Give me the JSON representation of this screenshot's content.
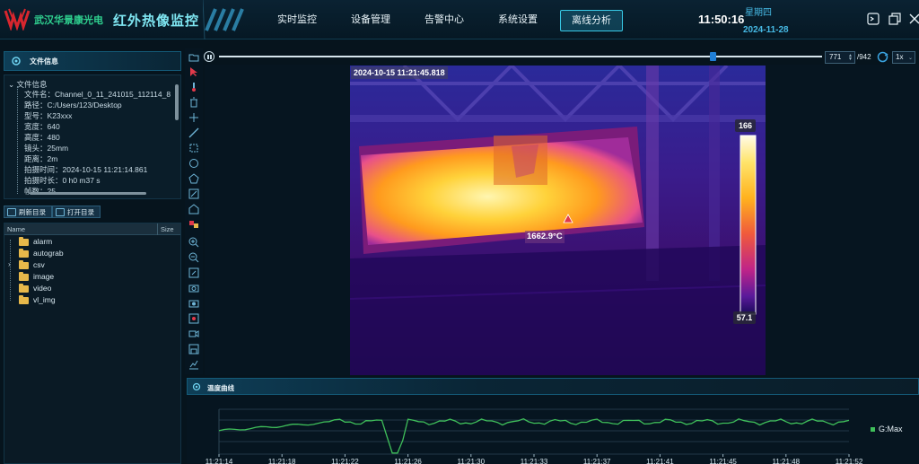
{
  "header": {
    "company": "武汉华景康光电",
    "system_name": "红外热像监控",
    "nav": [
      {
        "label": "实时监控",
        "active": false
      },
      {
        "label": "设备管理",
        "active": false
      },
      {
        "label": "告警中心",
        "active": false
      },
      {
        "label": "系统设置",
        "active": false
      },
      {
        "label": "离线分析",
        "active": true
      }
    ],
    "time": "11:50:16",
    "weekday": "星期四",
    "date": "2024-11-28"
  },
  "file_info": {
    "panel_title": "文件信息",
    "root_label": "文件信息",
    "rows": [
      "文件名：Channel_0_11_241015_112114_8",
      "路径：C:/Users/123/Desktop",
      "型号：K23xxx",
      "宽度：640",
      "高度：480",
      "镜头：25mm",
      "距离：2m",
      "拍摄时间：2024-10-15 11:21:14.861",
      "拍摄时长：0 h0 m37 s",
      "帧数：25"
    ]
  },
  "buttons": {
    "refresh": "刷新目录",
    "open": "打开目录"
  },
  "tree": {
    "col_name": "Name",
    "col_size": "Size",
    "folders": [
      {
        "name": "alarm",
        "expandable": false
      },
      {
        "name": "autograb",
        "expandable": false
      },
      {
        "name": "csv",
        "expandable": true
      },
      {
        "name": "image",
        "expandable": false
      },
      {
        "name": "video",
        "expandable": false
      },
      {
        "name": "vl_img",
        "expandable": false
      }
    ]
  },
  "playback": {
    "current_frame": "771",
    "total_frames": "/942",
    "speed": "1x",
    "progress": 0.818
  },
  "thermal": {
    "timestamp": "2024-10-15 11:21:45.818",
    "hotspot_label": "1662.9°C",
    "scale_max": "166",
    "scale_min": "57.1"
  },
  "curve": {
    "title": "温度曲线",
    "legend": "G:Max",
    "series_color": "#3fbf5a",
    "x_ticks": [
      "11:21:14",
      "11:21:18",
      "11:21:22",
      "11:21:26",
      "11:21:30",
      "11:21:33",
      "11:21:37",
      "11:21:41",
      "11:21:45",
      "11:21:48",
      "11:21:52"
    ]
  },
  "colors": {
    "accent": "#38c9e6",
    "brand_green": "#2fd08f",
    "header_bg": "#0a2232"
  }
}
